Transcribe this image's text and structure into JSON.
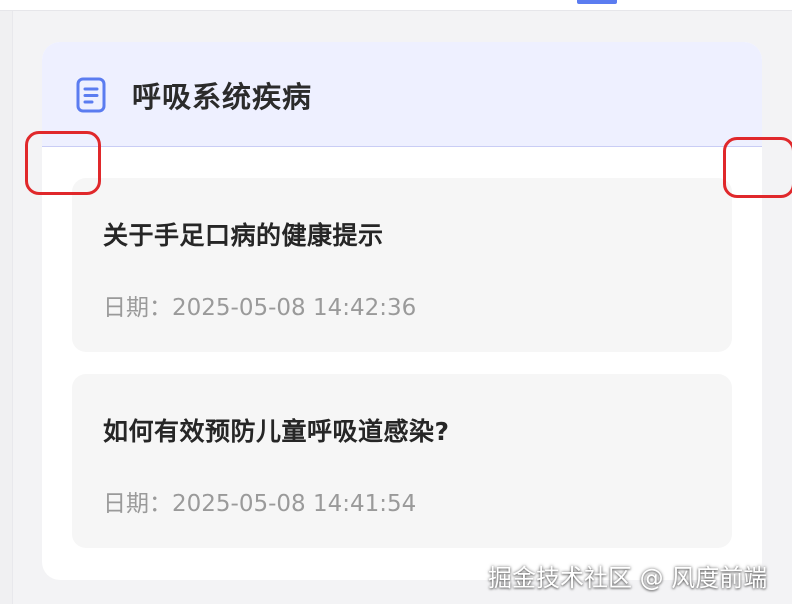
{
  "section": {
    "title": "呼吸系统疾病",
    "icon": "document-icon",
    "accent_color": "#5b7cf0",
    "header_background": "#eef0ff"
  },
  "articles": [
    {
      "title": "关于手足口病的健康提示",
      "date": "日期：2025-05-08 14:42:36"
    },
    {
      "title": "如何有效预防儿童呼吸道感染?",
      "date": "日期：2025-05-08 14:41:54"
    }
  ],
  "highlight_color": "#e0282b",
  "watermark": "掘金技术社区 @ 风度前端"
}
